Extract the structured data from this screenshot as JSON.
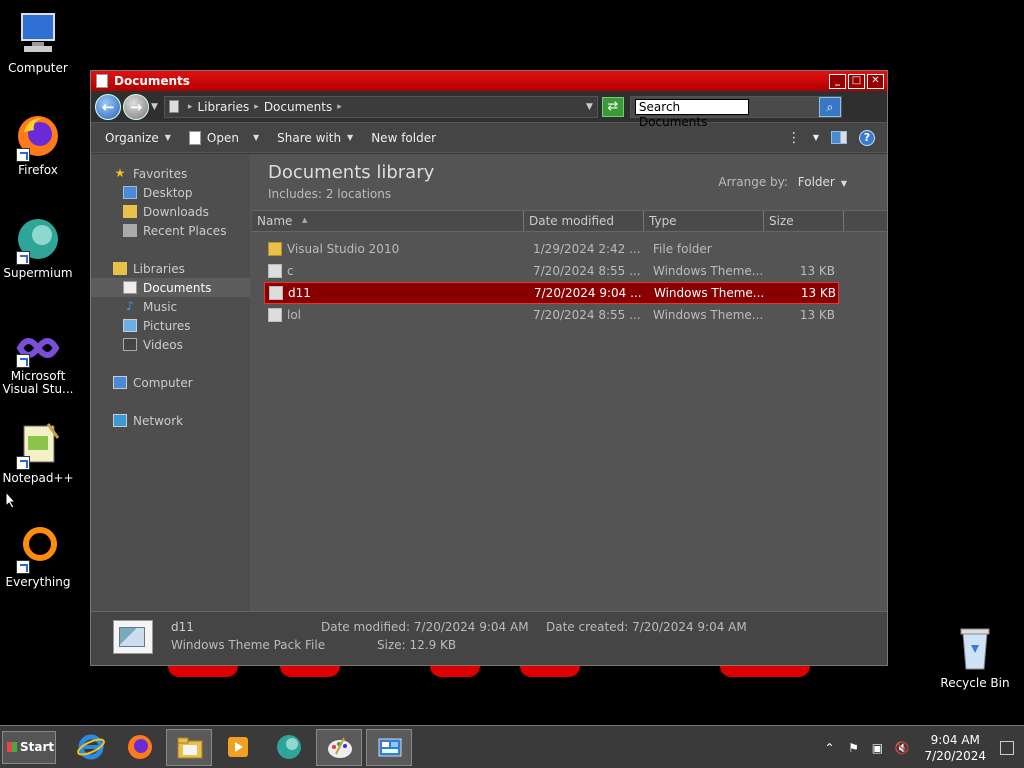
{
  "desktop": {
    "icons": [
      {
        "label": "Computer",
        "icon": "computer-icon"
      },
      {
        "label": "Firefox",
        "icon": "firefox-icon"
      },
      {
        "label": "Supermium",
        "icon": "supermium-icon"
      },
      {
        "label": "Microsoft Visual Stu...",
        "icon": "visual-studio-icon"
      },
      {
        "label": "Notepad++",
        "icon": "notepadpp-icon"
      },
      {
        "label": "Everything",
        "icon": "everything-icon"
      }
    ],
    "recycle_bin": {
      "label": "Recycle Bin",
      "icon": "recycle-bin-icon"
    }
  },
  "window": {
    "title": "Documents",
    "breadcrumb": [
      "Libraries",
      "Documents"
    ],
    "search_placeholder": "Search Documents",
    "toolbar": {
      "organize": "Organize",
      "open": "Open",
      "share_with": "Share with",
      "new_folder": "New folder"
    },
    "nav": {
      "favorites": "Favorites",
      "desktop": "Desktop",
      "downloads": "Downloads",
      "recent_places": "Recent Places",
      "libraries": "Libraries",
      "documents": "Documents",
      "music": "Music",
      "pictures": "Pictures",
      "videos": "Videos",
      "computer": "Computer",
      "network": "Network"
    },
    "library": {
      "title": "Documents library",
      "includes": "Includes:",
      "locations": "2 locations",
      "arrange_by_label": "Arrange by:",
      "arrange_by_value": "Folder"
    },
    "columns": {
      "name": "Name",
      "date": "Date modified",
      "type": "Type",
      "size": "Size"
    },
    "files": [
      {
        "name": "Visual Studio 2010",
        "date": "1/29/2024 2:42 ...",
        "type": "File folder",
        "size": ""
      },
      {
        "name": "c",
        "date": "7/20/2024 8:55 ...",
        "type": "Windows Theme...",
        "size": "13 KB"
      },
      {
        "name": "d11",
        "date": "7/20/2024 9:04 ...",
        "type": "Windows Theme...",
        "size": "13 KB"
      },
      {
        "name": "lol",
        "date": "7/20/2024 8:55 ...",
        "type": "Windows Theme...",
        "size": "13 KB"
      }
    ],
    "selected_index": 2,
    "details": {
      "name": "d11",
      "type": "Windows Theme Pack File",
      "date_modified": "Date modified: 7/20/2024 9:04 AM",
      "date_created": "Date created: 7/20/2024 9:04 AM",
      "size": "Size: 12.9 KB"
    }
  },
  "taskbar": {
    "start": "Start",
    "clock_time": "9:04 AM",
    "clock_date": "7/20/2024"
  }
}
